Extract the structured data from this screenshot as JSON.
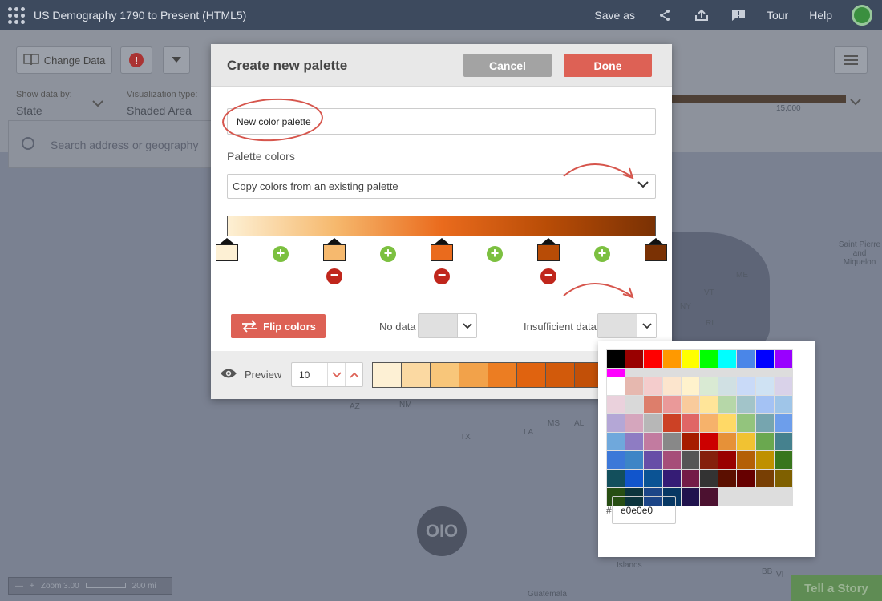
{
  "app": {
    "title": "US Demography 1790 to Present (HTML5)",
    "save_as": "Save as",
    "tour": "Tour",
    "help": "Help"
  },
  "toolbar": {
    "change_data": "Change Data",
    "info_symbol": "!",
    "show_data_by_label": "Show data by:",
    "show_data_by_value": "State",
    "viz_type_label": "Visualization type:",
    "viz_type_value": "Shaded Area",
    "legend_tick": "15,000",
    "search_placeholder": "Search address or geography"
  },
  "map": {
    "labels": [
      "Saint Pierre and Miquelon",
      "ME",
      "VT",
      "NY",
      "RI",
      "AZ",
      "NM",
      "TX",
      "MS",
      "AL",
      "LA",
      "Islands",
      "Guatemala",
      "VI",
      "BB"
    ],
    "zoom_text": "Zoom 3.00",
    "scale_text": "200 mi",
    "logo_text": "OIO",
    "tell_story": "Tell a Story"
  },
  "modal": {
    "title": "Create new palette",
    "cancel": "Cancel",
    "done": "Done",
    "palette_name": "New color palette",
    "palette_colors_label": "Palette colors",
    "copy_select": "Copy colors from an existing palette",
    "flip_colors": "Flip colors",
    "no_data_label": "No data",
    "insufficient_label": "Insufficient data",
    "preview_label": "Preview",
    "preview_count": "10",
    "stop_colors": [
      "#fdf0d4",
      "#f6b96e",
      "#ea6b1d",
      "#b84c06",
      "#7a3104"
    ],
    "preview_colors": [
      "#fdf0d4",
      "#fbd9a2",
      "#f8c67a",
      "#f2a24a",
      "#ec7d22",
      "#e0630f",
      "#d25a0b",
      "#c25008"
    ]
  },
  "picker": {
    "top_row": [
      "#000000",
      "#990000",
      "#ff0000",
      "#ff9900",
      "#ffff00",
      "#00ff00",
      "#00ffff",
      "#4a86e8",
      "#0000ff",
      "#9900ff",
      "#ff00ff"
    ],
    "grid": [
      [
        "#ffffff",
        "#e6b8af",
        "#f4cccc",
        "#fce5cd",
        "#fff2cc",
        "#d9ead3",
        "#d0e0e3",
        "#c9daf8",
        "#cfe2f3",
        "#d9d2e9",
        "#ead1dc"
      ],
      [
        "#d9d9d9",
        "#dd7e6b",
        "#ea9999",
        "#f9cb9c",
        "#ffe599",
        "#b6d7a8",
        "#a2c4c9",
        "#a4c2f4",
        "#9fc5e8",
        "#b4a7d6",
        "#d5a6bd"
      ],
      [
        "#b7b7b7",
        "#cc4125",
        "#e06666",
        "#f6b26b",
        "#ffd966",
        "#93c47d",
        "#76a5af",
        "#6d9eeb",
        "#6fa8dc",
        "#8e7cc3",
        "#c27ba0"
      ],
      [
        "#888888",
        "#a61c00",
        "#cc0000",
        "#e69138",
        "#f1c232",
        "#6aa84f",
        "#45818e",
        "#3c78d8",
        "#3d85c6",
        "#674ea7",
        "#a64d79"
      ],
      [
        "#555555",
        "#85200c",
        "#990000",
        "#b45f06",
        "#bf9000",
        "#38761d",
        "#134f5c",
        "#1155cc",
        "#0b5394",
        "#351c75",
        "#741b47"
      ],
      [
        "#333333",
        "#5b0f00",
        "#660000",
        "#783f04",
        "#7f6000",
        "#274e13",
        "#0c343d",
        "#1c4587",
        "#073763",
        "#20124d",
        "#4c1130"
      ]
    ],
    "hash": "#",
    "hex_value": "e0e0e0"
  }
}
